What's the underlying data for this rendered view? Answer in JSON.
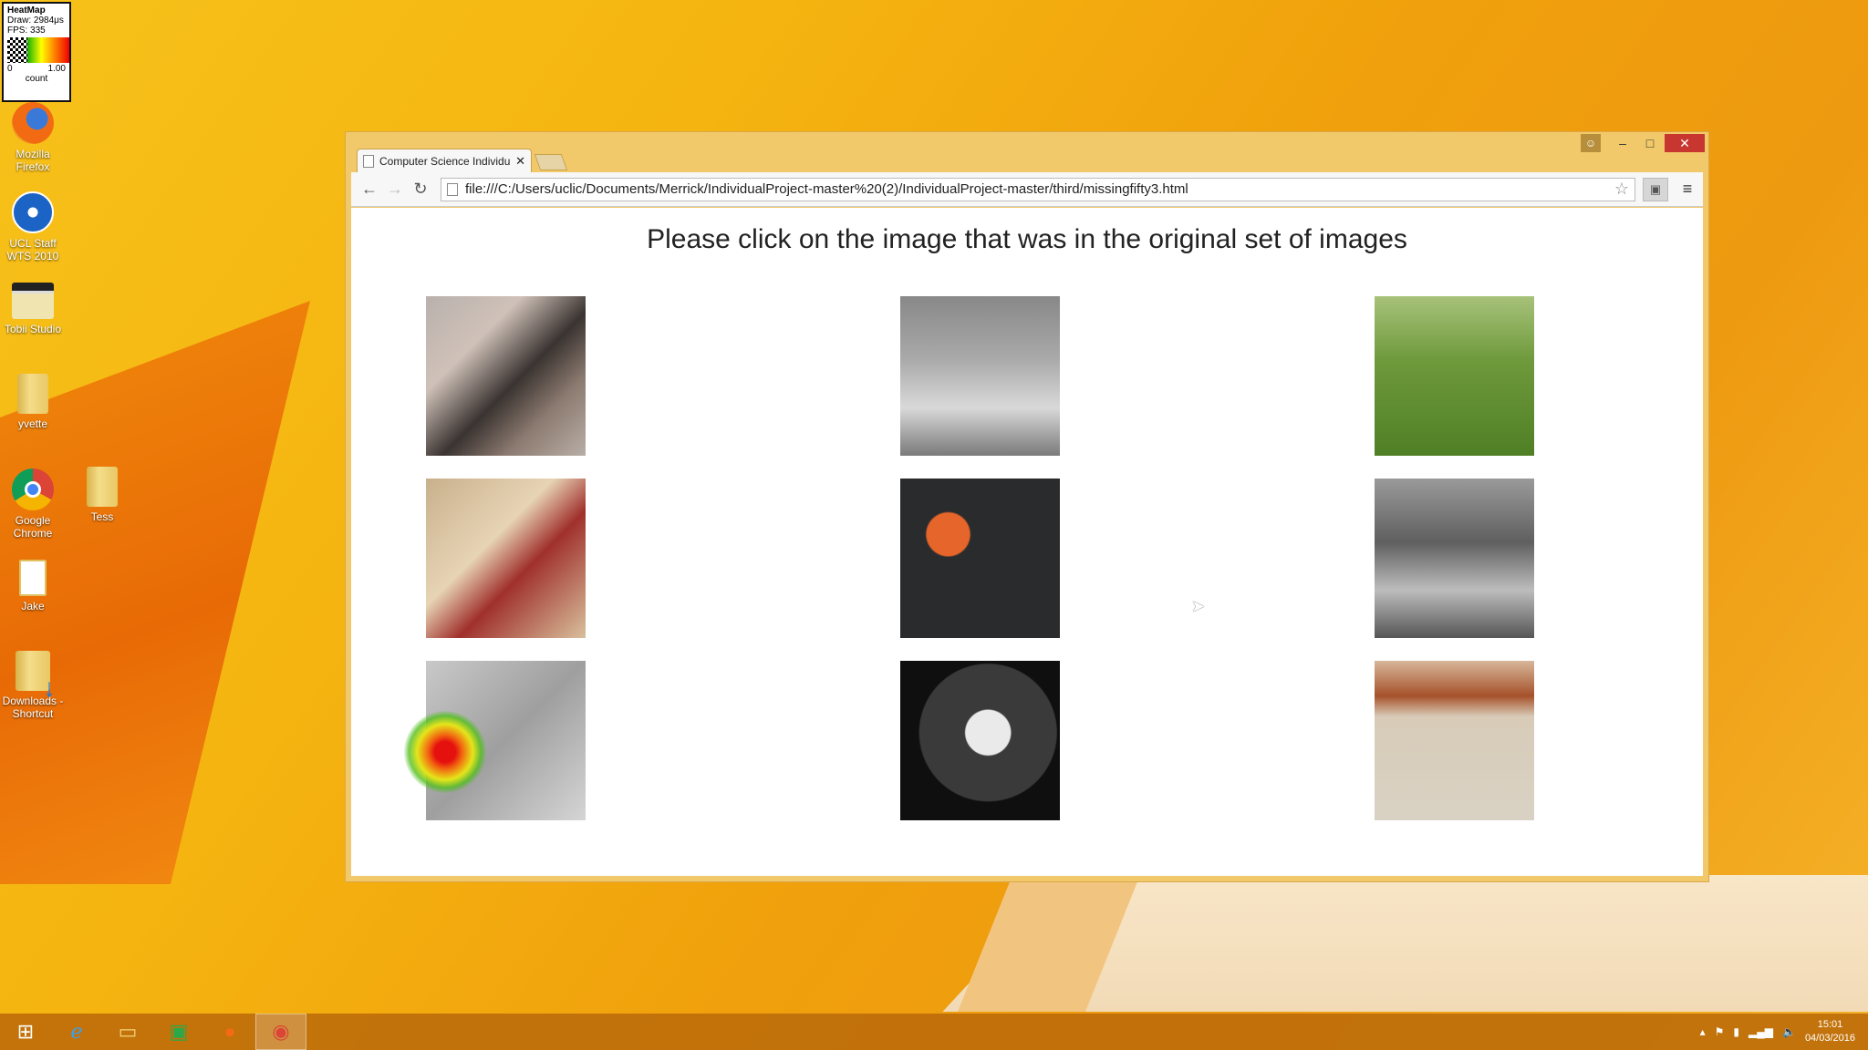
{
  "heatmap": {
    "title": "HeatMap",
    "draw": "Draw: 2984μs",
    "fps": "FPS: 335",
    "scale_min": "0",
    "scale_max": "1.00",
    "unit": "count"
  },
  "desktop_icons": [
    {
      "label": "Mozilla Firefox",
      "icon": "firefox-icon"
    },
    {
      "label": "UCL Staff WTS 2010",
      "icon": "remote-desktop-icon"
    },
    {
      "label": "Tobii Studio",
      "icon": "tobii-studio-icon"
    },
    {
      "label": "yvette",
      "icon": "folder-icon"
    },
    {
      "label": "Google Chrome",
      "icon": "chrome-icon"
    },
    {
      "label": "Tess",
      "icon": "folder-icon"
    },
    {
      "label": "Jake",
      "icon": "document-icon"
    },
    {
      "label": "Downloads - Shortcut",
      "icon": "downloads-folder-icon"
    }
  ],
  "browser": {
    "tab_title": "Computer Science Individu",
    "url": "file:///C:/Users/uclic/Documents/Merrick/IndividualProject-master%20(2)/IndividualProject-master/third/missingfifty3.html",
    "controls": {
      "user": "☺",
      "minimize": "–",
      "maximize": "□",
      "close": "✕"
    }
  },
  "page": {
    "heading": "Please click on the image that was in the original set of images",
    "images": [
      {
        "subject": "bearded man"
      },
      {
        "subject": "legs in jeans (grayscale)"
      },
      {
        "subject": "dog in grass"
      },
      {
        "subject": "tools and walnuts"
      },
      {
        "subject": "coffee cup with beans"
      },
      {
        "subject": "skateboard on fence (grayscale)"
      },
      {
        "subject": "key on wood (grayscale)"
      },
      {
        "subject": "car dashboard gauge"
      },
      {
        "subject": "wallet in pocket"
      }
    ]
  },
  "taskbar": {
    "items": [
      "start-icon",
      "internet-explorer-icon",
      "file-explorer-icon",
      "store-icon",
      "firefox-icon",
      "chrome-icon"
    ],
    "time": "15:01",
    "date": "04/03/2016"
  },
  "colors": {
    "desktop": "#f5b410",
    "window_frame": "#f2c96a",
    "close_button": "#c7372f",
    "taskbar": "#be6e0a"
  }
}
